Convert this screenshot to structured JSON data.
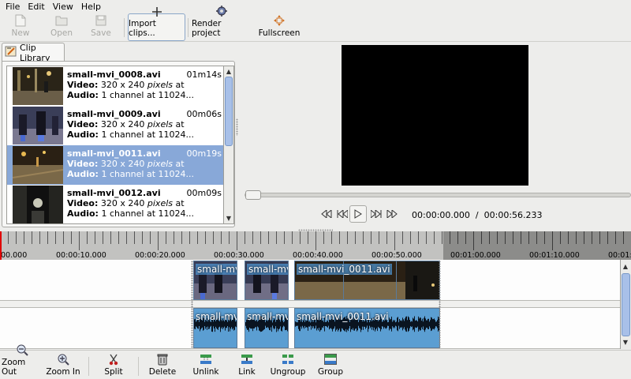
{
  "menubar": {
    "items": [
      "File",
      "Edit",
      "View",
      "Help"
    ]
  },
  "toolbar": {
    "new": "New",
    "open": "Open",
    "save": "Save",
    "import_clips": "Import clips...",
    "render_project": "Render project",
    "fullscreen": "Fullscreen"
  },
  "library": {
    "tab_label": "Clip Library",
    "clips": [
      {
        "name": "small-mvi_0008.avi",
        "duration": "01m14s",
        "video_label": "Video:",
        "video_res": "320 x 240",
        "video_unit": "pixels",
        "video_extra": " at",
        "audio_label": "Audio:",
        "audio_desc": "1 channel at 11024..."
      },
      {
        "name": "small-mvi_0009.avi",
        "duration": "00m06s",
        "video_label": "Video:",
        "video_res": "320 x 240",
        "video_unit": "pixels",
        "video_extra": " at",
        "audio_label": "Audio:",
        "audio_desc": "1 channel at 11024..."
      },
      {
        "name": "small-mvi_0011.avi",
        "duration": "00m19s",
        "video_label": "Video:",
        "video_res": "320 x 240",
        "video_unit": "pixels",
        "video_extra": " at",
        "audio_label": "Audio:",
        "audio_desc": "1 channel at 11024..."
      },
      {
        "name": "small-mvi_0012.avi",
        "duration": "00m09s",
        "video_label": "Video:",
        "video_res": "320 x 240",
        "video_unit": "pixels",
        "video_extra": " at",
        "audio_label": "Audio:",
        "audio_desc": "1 channel at 11024..."
      }
    ],
    "selected_index": 2
  },
  "viewer": {
    "position": "00:00:00.000",
    "separator": "/",
    "total": "00:00:56.233"
  },
  "ruler": {
    "labels": [
      "00.000",
      "00:00:10.000",
      "00:00:20.000",
      "00:00:30.000",
      "00:00:40.000",
      "00:00:50.000",
      "00:01:00.000",
      "00:01:10.000",
      "00:01:"
    ]
  },
  "timeline": {
    "video_clips": [
      "small-mvi",
      "small-mvi",
      "small-mvi_0011.avi"
    ],
    "audio_clips": [
      "small-mvi",
      "small-mvi",
      "small-mvi_0011.avi"
    ]
  },
  "bottombar": {
    "zoom_out": "Zoom Out",
    "zoom_in": "Zoom In",
    "split": "Split",
    "delete": "Delete",
    "unlink": "Unlink",
    "link": "Link",
    "ungroup": "Ungroup",
    "group": "Group"
  },
  "colors": {
    "selection": "#88a8d8",
    "playhead": "#e00000",
    "audio_clip": "#5b9ed2"
  }
}
